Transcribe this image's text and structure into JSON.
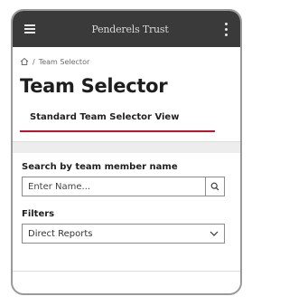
{
  "header": {
    "brand": "Penderels Trust"
  },
  "breadcrumb": {
    "separator": "/",
    "current": "Team Selector"
  },
  "page": {
    "title": "Team Selector"
  },
  "tabs": [
    {
      "label": "Standard Team Selector View"
    }
  ],
  "search": {
    "label": "Search by team member name",
    "placeholder": "Enter Name..."
  },
  "filters": {
    "label": "Filters",
    "selected": "Direct Reports"
  },
  "colors": {
    "appbar": "#3a3a3a",
    "accent": "#c8102e"
  },
  "icons": [
    "menu-icon",
    "more-vert-icon",
    "home-icon",
    "search-icon",
    "chevron-down-icon"
  ]
}
